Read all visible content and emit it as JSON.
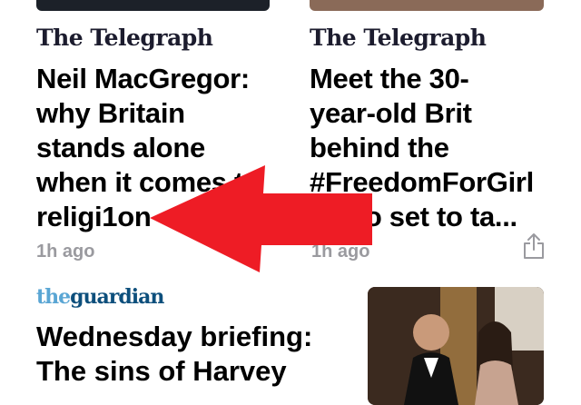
{
  "feed": {
    "top_left": {
      "source": "The Telegraph",
      "headline_lines": [
        "Neil MacGregor:",
        "why Britain",
        "stands alone",
        "when it comes to",
        "religi1on"
      ],
      "time": "1h ago"
    },
    "top_right": {
      "source": "The Telegraph",
      "headline_lines": [
        "Meet the 30-",
        "year-old Brit",
        "behind the",
        "#FreedomForGirl",
        "video set to ta..."
      ],
      "time": "1h ago"
    },
    "bottom_left": {
      "source_the": "the",
      "source_name": "guardian",
      "headline_lines": [
        "Wednesday briefing:",
        "The sins of Harvey"
      ]
    }
  },
  "overlay": {
    "arrow_color": "#ee1c25"
  }
}
